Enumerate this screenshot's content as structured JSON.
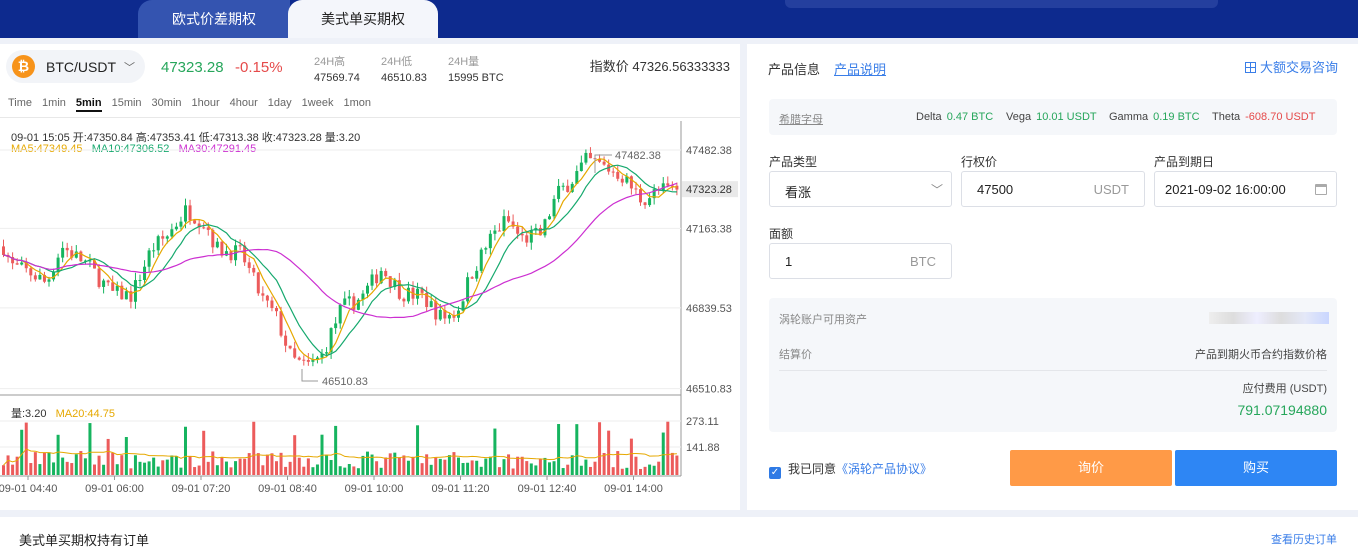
{
  "tabs": {
    "european": "欧式价差期权",
    "american": "美式单买期权"
  },
  "ticker": {
    "pair": "BTC/USDT",
    "coin_symbol": "₿",
    "price": "47323.28",
    "change": "-0.15%",
    "high_label": "24H高",
    "high": "47569.74",
    "low_label": "24H低",
    "low": "46510.83",
    "vol_label": "24H量",
    "vol": "15995 BTC",
    "index_price": "指数价 47326.56333333"
  },
  "intervals": [
    "Time",
    "1min",
    "5min",
    "15min",
    "30min",
    "1hour",
    "4hour",
    "1day",
    "1week",
    "1mon"
  ],
  "active_interval": "5min",
  "chart_info": {
    "ohlc": "09-01 15:05   开:47350.84  高:47353.41  低:47313.38  收:47323.28  量:3.20",
    "ma5": "MA5:47349.45",
    "ma10": "MA10:47306.52",
    "ma30": "MA30:47291.45",
    "vol": "量:3.20",
    "ma20": "MA20:44.75"
  },
  "chart_data": {
    "type": "candlestick",
    "price_axis_ticks": [
      47482.38,
      47323.28,
      47163.38,
      46839.53,
      46510.83
    ],
    "current_price_label": "47323.28",
    "volume_axis_ticks": [
      "273.11",
      "141.88"
    ],
    "time_ticks": [
      "09-01 04:40",
      "09-01 06:00",
      "09-01 07:20",
      "09-01 08:40",
      "09-01 10:00",
      "09-01 11:20",
      "09-01 12:40",
      "09-01 14:00"
    ],
    "max_marker": "47482.38",
    "min_marker": "46510.83",
    "ylim": [
      46440,
      47560
    ]
  },
  "colors": {
    "up": "#16b45f",
    "down": "#ec5b5b",
    "ma5": "#e6a800",
    "ma10": "#16a96e",
    "ma30": "#cc2fd1"
  },
  "product": {
    "info_label": "产品信息",
    "desc_link": "产品说明",
    "bulk_link": "大额交易咨询",
    "greeks_label": "希腊字母",
    "delta_label": "Delta",
    "delta": "0.47 BTC",
    "vega_label": "Vega",
    "vega": "10.01 USDT",
    "gamma_label": "Gamma",
    "gamma": "0.19 BTC",
    "theta_label": "Theta",
    "theta": "-608.70 USDT"
  },
  "form": {
    "type_label": "产品类型",
    "type_value": "看涨",
    "strike_label": "行权价",
    "strike_value": "47500",
    "strike_unit": "USDT",
    "expiry_label": "产品到期日",
    "expiry_value": "2021-09-02 16:00:00",
    "amount_label": "面额",
    "amount_value": "1",
    "amount_unit": "BTC"
  },
  "account": {
    "assets_label": "涡轮账户可用资产",
    "settle_label": "结算价",
    "settle_value": "产品到期火币合约指数价格",
    "fee_label": "应付费用 (USDT)",
    "fee_value": "791.07194880"
  },
  "agree": {
    "text": "我已同意",
    "link": "《涡轮产品协议》"
  },
  "buttons": {
    "inquire": "询价",
    "buy": "购买"
  },
  "orders": {
    "title": "美式单买期权持有订单",
    "history_link": "查看历史订单"
  }
}
